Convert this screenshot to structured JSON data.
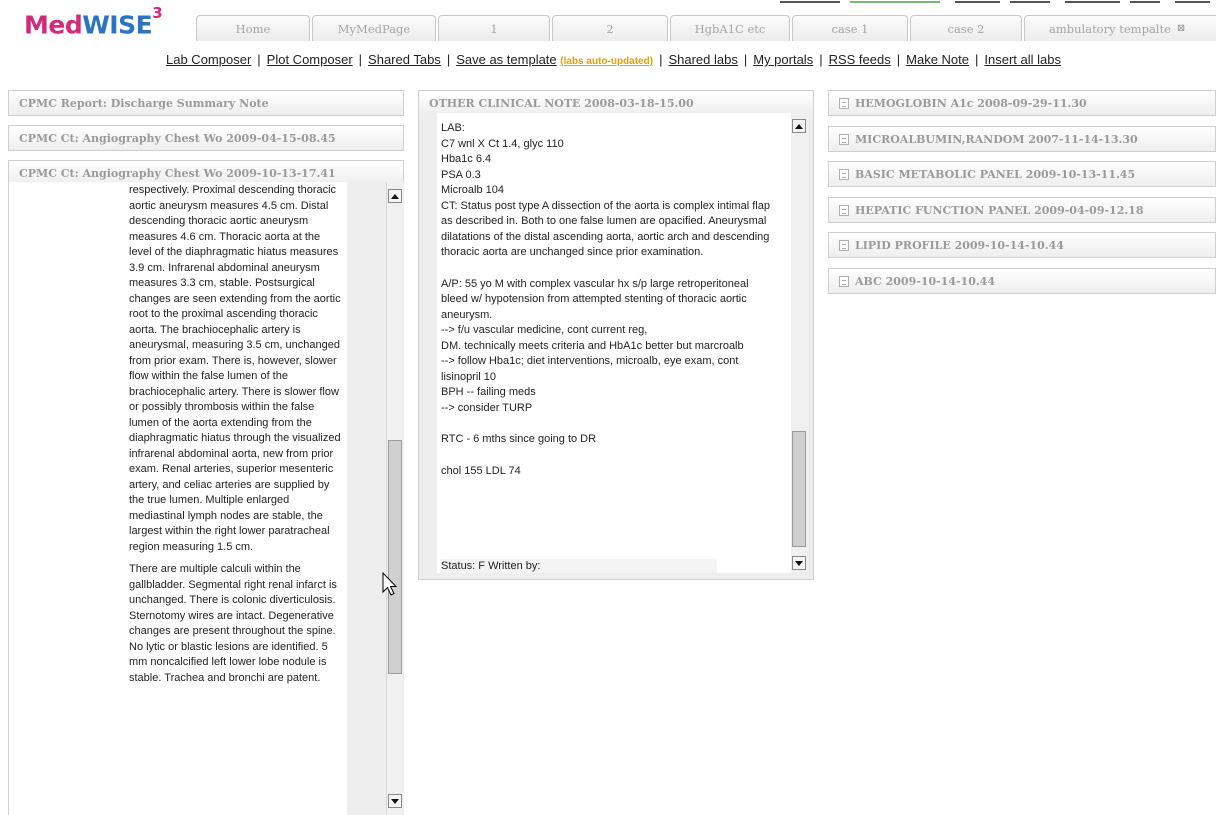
{
  "logo": {
    "main_a": "Med",
    "main_b": "WISE",
    "sup": "3"
  },
  "tabs": [
    {
      "label": "Home"
    },
    {
      "label": "MyMedPage"
    },
    {
      "label": "1"
    },
    {
      "label": "2"
    },
    {
      "label": "HgbA1C etc"
    },
    {
      "label": "case 1"
    },
    {
      "label": "case 2"
    },
    {
      "label": "ambulatory tempalte"
    }
  ],
  "linkbar": {
    "lab_composer": "Lab Composer",
    "plot_composer": "Plot Composer",
    "shared_tabs": "Shared Tabs",
    "save_template": "Save as template",
    "auto_updated": "(labs auto-updated)",
    "shared_labs": "Shared labs",
    "my_portals": "My portals",
    "rss": "RSS feeds",
    "make_note": "Make Note",
    "insert_all": "Insert all labs"
  },
  "left_column": {
    "headers": [
      "CPMC Report: Discharge Summary Note",
      "CPMC Ct: Angiography Chest Wo 2009-04-15-08.45",
      "CPMC Ct: Angiography Chest Wo 2009-10-13-17.41"
    ],
    "report_p1": "respectively. Proximal descending thoracic aortic aneurysm measures 4.5 cm. Distal descending thoracic aortic aneurysm measures 4.6 cm. Thoracic aorta at the level of the diaphragmatic hiatus measures 3.9 cm. Infrarenal abdominal aneurysm measures 3.3 cm, stable. Postsurgical changes are seen extending from the aortic root to the proximal ascending thoracic aorta. The brachiocephalic artery is aneurysmal, measuring 3.5 cm, unchanged from prior exam. There is, however, slower flow within the false lumen of the brachiocephalic artery. There is slower flow or possibly thrombosis within the false lumen of the aorta extending from the diaphragmatic hiatus through the visualized infrarenal abdominal aorta, new from prior exam. Renal arteries, superior mesenteric artery, and celiac arteries are supplied by the true lumen. Multiple enlarged mediastinal lymph nodes are stable, the largest within the right lower paratracheal region measuring 1.5 cm.",
    "report_p2": "There are multiple calculi within the gallbladder. Segmental right renal infarct is unchanged. There is colonic diverticulosis. Sternotomy wires are intact. Degenerative changes are present throughout the spine. No lytic or blastic lesions are identified. 5 mm noncalcified left lower lobe nodule is stable. Trachea and bronchi are patent."
  },
  "middle_column": {
    "header": "OTHER CLINICAL NOTE 2008-03-18-15.00",
    "lines": [
      "LAB:",
      "C7 wnl X Ct 1.4, glyc 110",
      "Hba1c 6.4",
      "PSA 0.3",
      "Microalb 104",
      "CT: Status post type A dissection of the aorta is complex intimal flap as described in. Both to one false lumen are opacified. Aneurysmal dilatations of the distal ascending aorta, aortic arch and descending thoracic aorta are unchanged since prior examination.",
      "",
      "A/P: 55 yo M with complex vascular hx s/p large retroperitoneal bleed w/ hypotension from attempted stenting of thoracic aortic aneurysm.",
      "--> f/u vascular medicine, cont current reg,",
      "DM. technically meets criteria and HbA1c better but marcroalb",
      "--> follow Hba1c; diet interventions, microalb, eye exam, cont lisinopril 10",
      "BPH -- failing meds",
      "--> consider TURP",
      "",
      "RTC - 6 mths since going to DR",
      "",
      "chol 155 LDL 74"
    ],
    "status_line": "Status: F   Written by:"
  },
  "right_column": {
    "items": [
      "HEMOGLOBIN A1c 2008-09-29-11.30",
      "MICROALBUMIN,RANDOM 2007-11-14-13.30",
      "BASIC METABOLIC PANEL 2009-10-13-11.45",
      "HEPATIC FUNCTION PANEL 2009-04-09-12.18",
      "LIPID PROFILE 2009-10-14-10.44",
      "ABC 2009-10-14-10.44"
    ]
  }
}
